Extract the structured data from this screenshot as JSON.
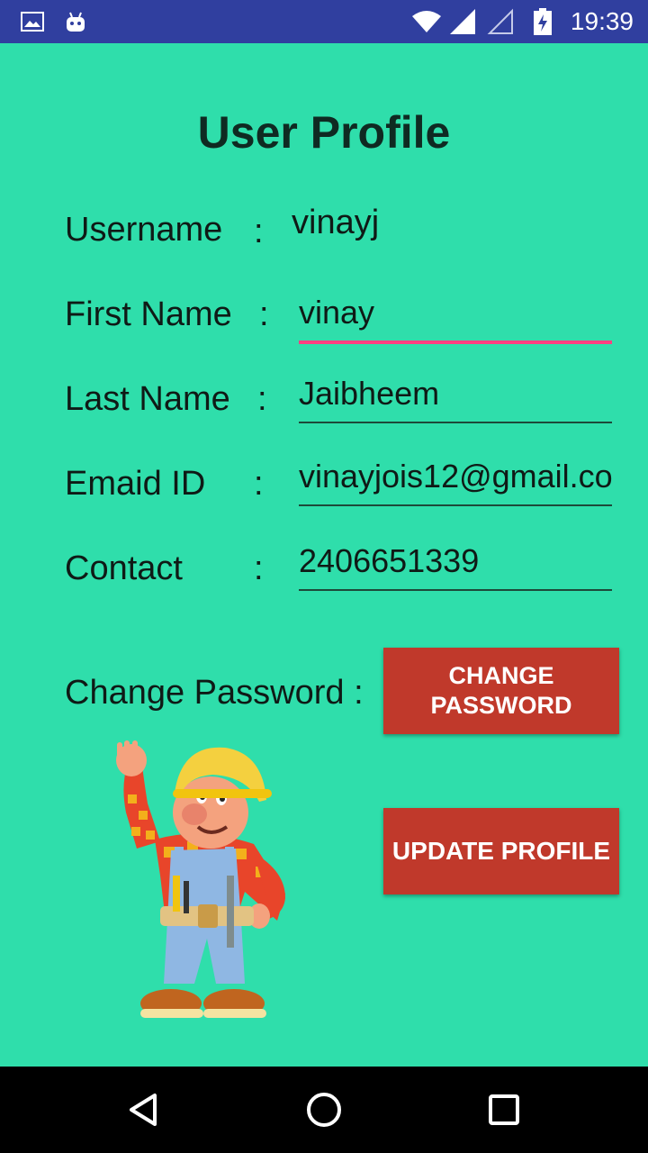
{
  "status_bar": {
    "time": "19:39",
    "icons": [
      "image-icon",
      "android-icon",
      "wifi-icon",
      "signal-icon",
      "signal-empty-icon",
      "battery-charging-icon"
    ]
  },
  "page": {
    "title": "User Profile"
  },
  "fields": {
    "username": {
      "label": "Username",
      "colon": ":",
      "value": "vinayj"
    },
    "first_name": {
      "label": "First Name",
      "colon": ":",
      "value": "vinay"
    },
    "last_name": {
      "label": "Last Name",
      "colon": ":",
      "value": "Jaibheem"
    },
    "email": {
      "label": "Emaid ID",
      "colon": ":",
      "value": "vinayjois12@gmail.co"
    },
    "contact": {
      "label": "Contact",
      "colon": ":",
      "value": "2406651339"
    }
  },
  "change_password": {
    "label": "Change Password :",
    "button_line1": "CHANGE",
    "button_line2": "PASSWORD"
  },
  "update_button": "UPDATE PROFILE",
  "colors": {
    "background": "#2fdeab",
    "status_bar": "#303f9f",
    "button": "#c0392b",
    "focus_underline": "#ff4081"
  },
  "nav_bar": {
    "icons": [
      "back-icon",
      "home-icon",
      "recents-icon"
    ]
  }
}
